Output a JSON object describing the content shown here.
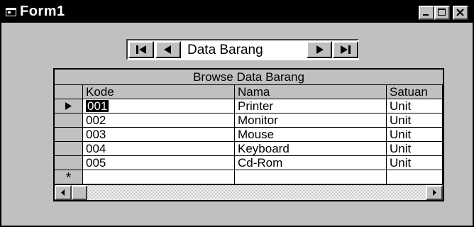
{
  "window": {
    "title": "Form1",
    "icon": "form-icon",
    "controls": [
      "minimize-icon",
      "maximize-icon",
      "close-icon"
    ]
  },
  "data_control": {
    "caption": "Data Barang",
    "buttons": [
      "first-record-icon",
      "previous-record-icon",
      "next-record-icon",
      "last-record-icon"
    ]
  },
  "grid": {
    "caption": "Browse Data Barang",
    "columns": [
      "Kode",
      "Nama",
      "Satuan"
    ],
    "rows": [
      [
        "001",
        "Printer",
        "Unit"
      ],
      [
        "002",
        "Monitor",
        "Unit"
      ],
      [
        "003",
        "Mouse",
        "Unit"
      ],
      [
        "004",
        "Keyboard",
        "Unit"
      ],
      [
        "005",
        "Cd-Rom",
        "Unit"
      ]
    ],
    "current_row": 1,
    "new_row_marker": "*"
  },
  "colors": {
    "face": "#c0c0c0",
    "titlebar": "#000000",
    "cell": "#ffffff"
  }
}
